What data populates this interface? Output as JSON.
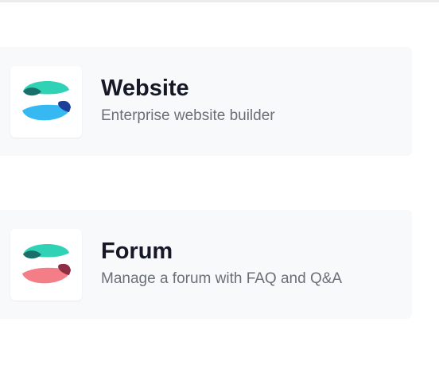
{
  "apps": [
    {
      "title": "Website",
      "description": "Enterprise website builder",
      "icon": "website-app-icon",
      "colors": {
        "top": "#2fd2b4",
        "top_shadow": "#1a6f6a",
        "bottom": "#36b9f2",
        "bottom_shadow": "#1e3f99"
      }
    },
    {
      "title": "Forum",
      "description": "Manage a forum with FAQ and Q&A",
      "icon": "forum-app-icon",
      "colors": {
        "top": "#2fd2b4",
        "top_shadow": "#1a6f6a",
        "bottom": "#f47e87",
        "bottom_shadow": "#8f2d45"
      }
    }
  ]
}
